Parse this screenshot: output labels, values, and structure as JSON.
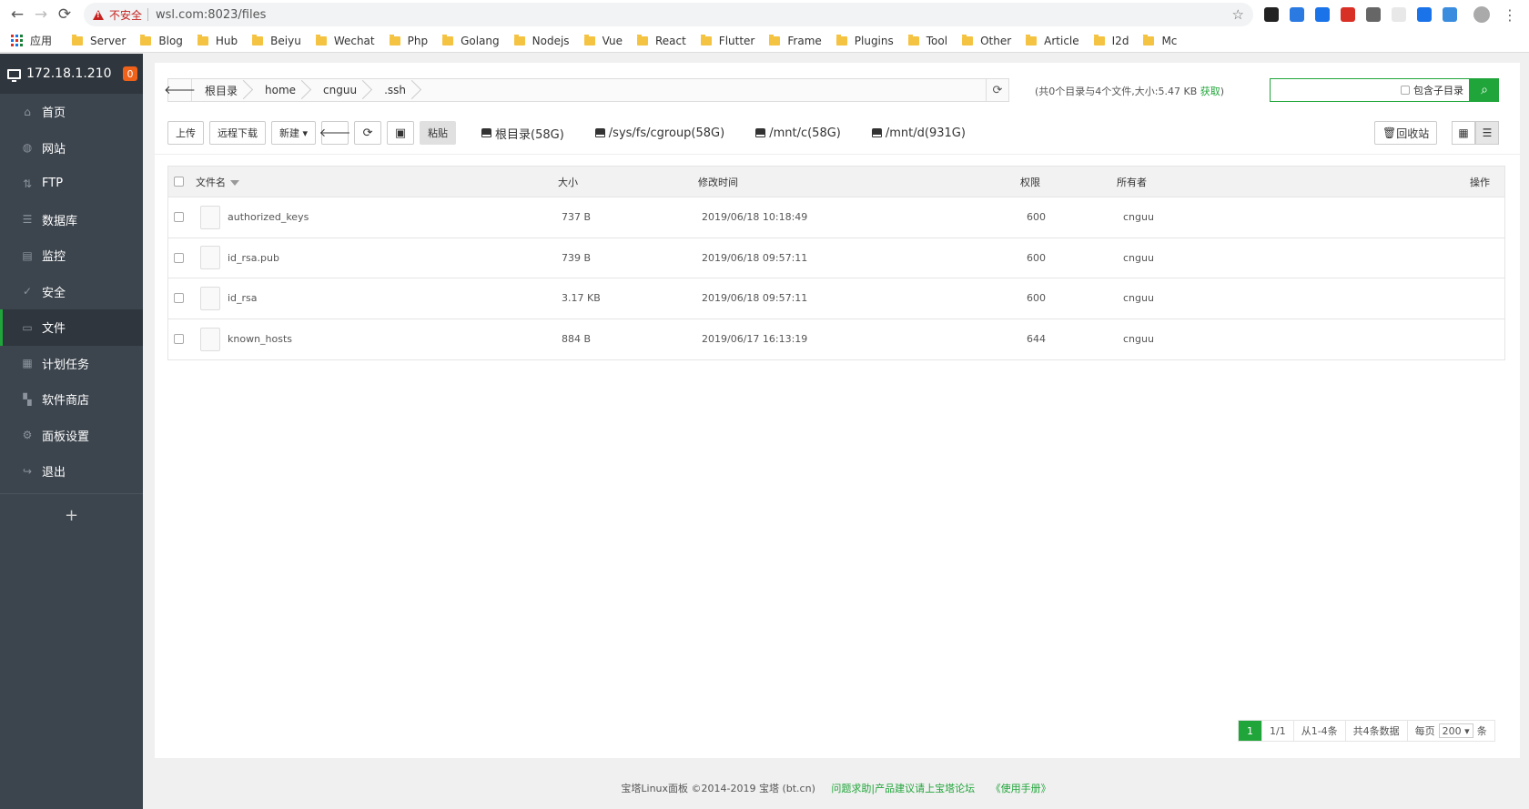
{
  "browser": {
    "security_label": "不安全",
    "url": "wsl.com:8023/files",
    "apps_label": "应用",
    "bookmarks": [
      "Server",
      "Blog",
      "Hub",
      "Beiyu",
      "Wechat",
      "Php",
      "Golang",
      "Nodejs",
      "Vue",
      "React",
      "Flutter",
      "Frame",
      "Plugins",
      "Tool",
      "Other",
      "Article",
      "I2d",
      "Mc"
    ],
    "extension_colors": [
      "#222222",
      "#2a7ae2",
      "#1a73e8",
      "#d93025",
      "#666666",
      "#e8e8e8",
      "#1a73e8",
      "#3a8dde"
    ]
  },
  "sidebar": {
    "ip": "172.18.1.210",
    "badge": "0",
    "items": [
      {
        "label": "首页",
        "icon": "home-icon",
        "glyph": "⌂"
      },
      {
        "label": "网站",
        "icon": "globe-icon",
        "glyph": "◍"
      },
      {
        "label": "FTP",
        "icon": "ftp-icon",
        "glyph": "⇅"
      },
      {
        "label": "数据库",
        "icon": "database-icon",
        "glyph": "☰"
      },
      {
        "label": "监控",
        "icon": "monitor-chart-icon",
        "glyph": "▤"
      },
      {
        "label": "安全",
        "icon": "shield-icon",
        "glyph": "✓"
      },
      {
        "label": "文件",
        "icon": "folder-icon",
        "glyph": "▭"
      },
      {
        "label": "计划任务",
        "icon": "calendar-icon",
        "glyph": "▦"
      },
      {
        "label": "软件商店",
        "icon": "apps-grid-icon",
        "glyph": "▚"
      },
      {
        "label": "面板设置",
        "icon": "gear-icon",
        "glyph": "⚙"
      },
      {
        "label": "退出",
        "icon": "logout-icon",
        "glyph": "↪"
      }
    ],
    "active_index": 6,
    "add_glyph": "+"
  },
  "pathbar": {
    "back_glyph": "🡐",
    "crumbs": [
      "根目录",
      "home",
      "cnguu",
      ".ssh"
    ],
    "refresh_glyph": "⟳"
  },
  "summary": {
    "text": "(共0个目录与4个文件,大小:5.47 KB ",
    "link": "获取",
    "close": ")"
  },
  "search": {
    "placeholder": "",
    "include_subdir": "包含子目录",
    "button_glyph": "⌕"
  },
  "toolbar": {
    "upload": "上传",
    "remote_download": "远程下载",
    "new": "新建 ▾",
    "back_glyph": "🡐",
    "refresh_glyph": "⟳",
    "terminal_glyph": "▣",
    "paste": "粘贴",
    "disks": [
      "根目录(58G)",
      "/sys/fs/cgroup(58G)",
      "/mnt/c(58G)",
      "/mnt/d(931G)"
    ],
    "recycle": "回收站",
    "recycle_glyph": "🗑",
    "grid_glyph": "▦",
    "list_glyph": "☰"
  },
  "table": {
    "headers": {
      "name": "文件名",
      "size": "大小",
      "mtime": "修改时间",
      "perm": "权限",
      "owner": "所有者",
      "ops": "操作"
    },
    "rows": [
      {
        "name": "authorized_keys",
        "size": "737 B",
        "mtime": "2019/06/18 10:18:49",
        "perm": "600",
        "owner": "cnguu"
      },
      {
        "name": "id_rsa.pub",
        "size": "739 B",
        "mtime": "2019/06/18 09:57:11",
        "perm": "600",
        "owner": "cnguu"
      },
      {
        "name": "id_rsa",
        "size": "3.17 KB",
        "mtime": "2019/06/18 09:57:11",
        "perm": "600",
        "owner": "cnguu"
      },
      {
        "name": "known_hosts",
        "size": "884 B",
        "mtime": "2019/06/17 16:13:19",
        "perm": "644",
        "owner": "cnguu"
      }
    ]
  },
  "pager": {
    "current": "1",
    "pages": "1/1",
    "range": "从1-4条",
    "total": "共4条数据",
    "per_page_label": "每页",
    "per_page": "200",
    "per_page_unit": "条"
  },
  "footer": {
    "copyright": "宝塔Linux面板 ©2014-2019 宝塔 (bt.cn)",
    "forum": "问题求助|产品建议请上宝塔论坛",
    "manual": "《使用手册》"
  }
}
